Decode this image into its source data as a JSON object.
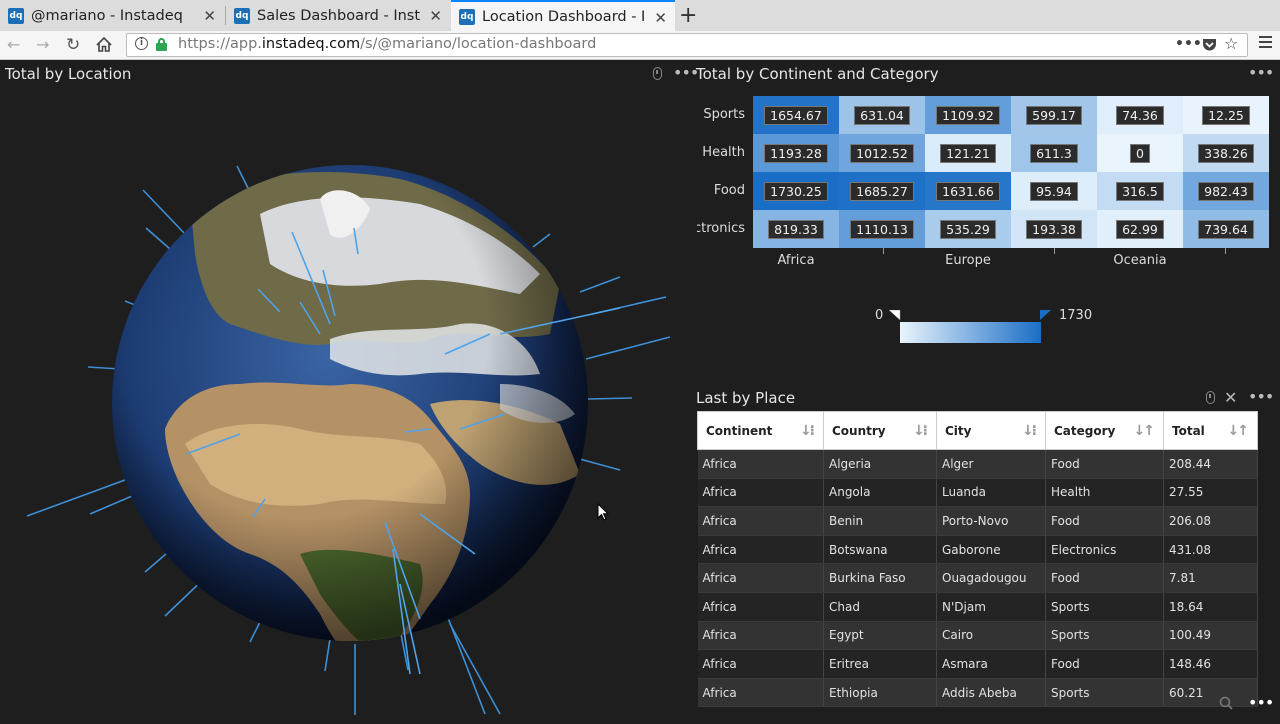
{
  "browser": {
    "tabs": [
      {
        "title": "@mariano - Instadeq",
        "favicon": "dq",
        "active": false
      },
      {
        "title": "Sales Dashboard - Inst",
        "favicon": "dq",
        "active": false
      },
      {
        "title": "Location Dashboard - I",
        "favicon": "dq",
        "active": true
      }
    ],
    "url_prefix": "https://app.",
    "url_domain": "instadeq.com",
    "url_path": "/s/@mariano/location-dashboard"
  },
  "globe_panel": {
    "title": "Total by Location"
  },
  "heatmap_panel": {
    "title": "Total by Continent and Category"
  },
  "table_panel": {
    "title": "Last by Place"
  },
  "chart_data": {
    "type": "heatmap",
    "rows": [
      "Sports",
      "Health",
      "Food",
      "Electronics"
    ],
    "x_tick_labels": [
      "Africa",
      "Europe",
      "Oceania"
    ],
    "values": [
      [
        1654.67,
        631.04,
        1109.92,
        599.17,
        74.36,
        12.25
      ],
      [
        1193.28,
        1012.52,
        121.21,
        611.3,
        0,
        338.26
      ],
      [
        1730.25,
        1685.27,
        1631.66,
        95.94,
        316.5,
        982.43
      ],
      [
        819.33,
        1110.13,
        535.29,
        193.38,
        62.99,
        739.64
      ]
    ],
    "value_range": [
      0,
      1730
    ],
    "colors": {
      "low": "#e9f4fd",
      "high": "#1a6ec6"
    },
    "legend_min_label": "0",
    "legend_max_label": "1730"
  },
  "table": {
    "columns": [
      "Continent",
      "Country",
      "City",
      "Category",
      "Total"
    ],
    "rows": [
      [
        "Africa",
        "Algeria",
        "Alger",
        "Food",
        "208.44"
      ],
      [
        "Africa",
        "Angola",
        "Luanda",
        "Health",
        "27.55"
      ],
      [
        "Africa",
        "Benin",
        "Porto-Novo",
        "Food",
        "206.08"
      ],
      [
        "Africa",
        "Botswana",
        "Gaborone",
        "Electronics",
        "431.08"
      ],
      [
        "Africa",
        "Burkina Faso",
        "Ouagadougou",
        "Food",
        "7.81"
      ],
      [
        "Africa",
        "Chad",
        "N'Djam",
        "Sports",
        "18.64"
      ],
      [
        "Africa",
        "Egypt",
        "Cairo",
        "Sports",
        "100.49"
      ],
      [
        "Africa",
        "Eritrea",
        "Asmara",
        "Food",
        "148.46"
      ],
      [
        "Africa",
        "Ethiopia",
        "Addis Abeba",
        "Sports",
        "60.21"
      ]
    ]
  },
  "icons": {
    "back": "arrow-left-icon",
    "forward": "arrow-right-icon",
    "reload": "reload-icon",
    "home": "home-icon",
    "more": "ellipsis-icon",
    "pocket": "pocket-icon",
    "bookmark": "star-icon",
    "menu": "hamburger-icon"
  }
}
